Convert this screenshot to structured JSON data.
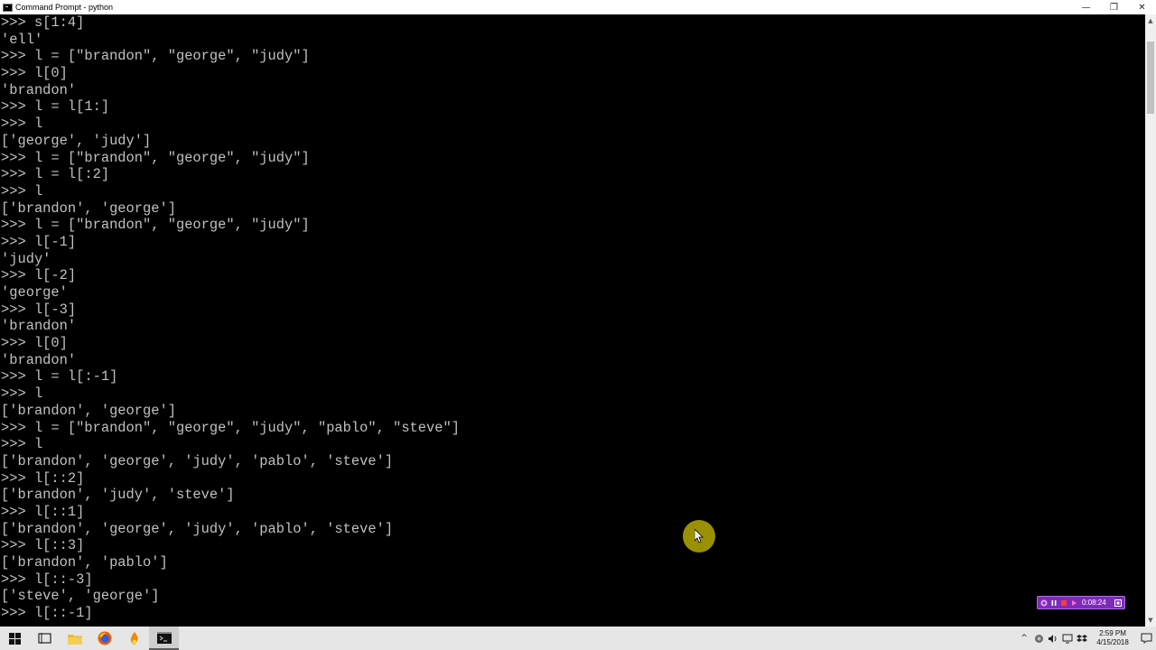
{
  "window": {
    "title": "Command Prompt - python",
    "minimize_glyph": "—",
    "restore_glyph": "❐",
    "close_glyph": "✕"
  },
  "console": {
    "lines": [
      ">>> s[1:4]",
      "'ell'",
      ">>> l = [\"brandon\", \"george\", \"judy\"]",
      ">>> l[0]",
      "'brandon'",
      ">>> l = l[1:]",
      ">>> l",
      "['george', 'judy']",
      ">>> l = [\"brandon\", \"george\", \"judy\"]",
      ">>> l = l[:2]",
      ">>> l",
      "['brandon', 'george']",
      ">>> l = [\"brandon\", \"george\", \"judy\"]",
      ">>> l[-1]",
      "'judy'",
      ">>> l[-2]",
      "'george'",
      ">>> l[-3]",
      "'brandon'",
      ">>> l[0]",
      "'brandon'",
      ">>> l = l[:-1]",
      ">>> l",
      "['brandon', 'george']",
      ">>> l = [\"brandon\", \"george\", \"judy\", \"pablo\", \"steve\"]",
      ">>> l",
      "['brandon', 'george', 'judy', 'pablo', 'steve']",
      ">>> l[::2]",
      "['brandon', 'judy', 'steve']",
      ">>> l[::1]",
      "['brandon', 'george', 'judy', 'pablo', 'steve']",
      ">>> l[::3]",
      "['brandon', 'pablo']",
      ">>> l[::-3]",
      "['steve', 'george']",
      ">>> l[::-1]"
    ]
  },
  "scrollbar": {
    "up_glyph": "▲",
    "down_glyph": "▼"
  },
  "recorder": {
    "elapsed": "0:08:24"
  },
  "taskbar": {
    "tray_chevron": "^",
    "clock_time": "2:59 PM",
    "clock_date": "4/15/2018"
  },
  "colors": {
    "console_bg": "#000000",
    "console_text": "#c0c0c0",
    "taskbar_bg": "#e6e6e6",
    "recorder_bg": "#7d2bb8",
    "cursor_halo": "#b4aa00"
  }
}
